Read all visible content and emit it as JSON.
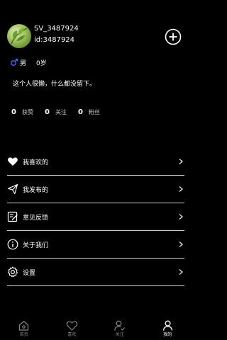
{
  "profile": {
    "username": "SV_3487924",
    "user_id": "id:3487924",
    "gender": "男",
    "age": "0岁",
    "bio": "这个人很懒，什么都没留下。",
    "avatar_icon": "leaf-avatar",
    "add_icon": "plus-circle-icon",
    "gender_icon": "male-icon",
    "gender_color": "#4a6cf7"
  },
  "stats": [
    {
      "count": "0",
      "label": "获赞"
    },
    {
      "count": "0",
      "label": "关注"
    },
    {
      "count": "0",
      "label": "粉丝"
    }
  ],
  "menu": [
    {
      "label": "我喜欢的",
      "icon": "heart-icon"
    },
    {
      "label": "我发布的",
      "icon": "send-icon"
    },
    {
      "label": "意见反馈",
      "icon": "feedback-icon"
    },
    {
      "label": "关于我们",
      "icon": "info-icon"
    },
    {
      "label": "设置",
      "icon": "settings-icon"
    }
  ],
  "tabbar": {
    "tabs": [
      {
        "label": "首页",
        "icon": "home-icon"
      },
      {
        "label": "喜欢",
        "icon": "heart-outline-icon"
      },
      {
        "label": "关注",
        "icon": "user-check-icon"
      },
      {
        "label": "我的",
        "icon": "user-icon"
      }
    ],
    "active_tab": "我的"
  },
  "colors": {
    "background": "#000000",
    "text": "#ffffff",
    "divider": "#cfcfcf",
    "tab_inactive": "#888888"
  }
}
